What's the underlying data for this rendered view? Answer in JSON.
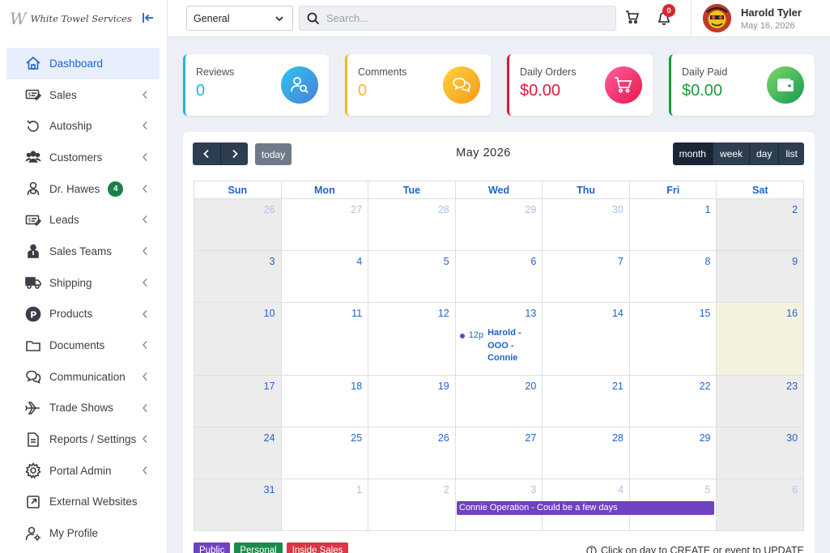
{
  "brand": {
    "logo_mark": "W",
    "logo_text": "White Towel Services"
  },
  "sidebar": {
    "items": [
      {
        "label": "Dashboard",
        "icon": "home-icon",
        "active": true
      },
      {
        "label": "Sales",
        "icon": "sales-icon"
      },
      {
        "label": "Autoship",
        "icon": "autoship-icon"
      },
      {
        "label": "Customers",
        "icon": "customers-icon"
      },
      {
        "label": "Dr. Hawes",
        "icon": "doctor-icon",
        "badge": "4"
      },
      {
        "label": "Leads",
        "icon": "leads-icon"
      },
      {
        "label": "Sales Teams",
        "icon": "sales-teams-icon"
      },
      {
        "label": "Shipping",
        "icon": "shipping-icon"
      },
      {
        "label": "Products",
        "icon": "products-icon"
      },
      {
        "label": "Documents",
        "icon": "folder-icon"
      },
      {
        "label": "Communication",
        "icon": "chat-icon"
      },
      {
        "label": "Trade Shows",
        "icon": "plane-icon"
      },
      {
        "label": "Reports / Settings",
        "icon": "document-icon"
      },
      {
        "label": "Portal Admin",
        "icon": "gear-icon"
      },
      {
        "label": "External Websites",
        "icon": "external-link-icon"
      },
      {
        "label": "My Profile",
        "icon": "user-gear-icon"
      }
    ]
  },
  "topbar": {
    "select_value": "General",
    "search_placeholder": "Search...",
    "notification_count": "0",
    "user_name": "Harold Tyler",
    "user_date": "May 16, 2026"
  },
  "cards": [
    {
      "label": "Reviews",
      "value": "0",
      "color": "#1fb6e8",
      "icon": "search-user-icon"
    },
    {
      "label": "Comments",
      "value": "0",
      "color": "#f5b921",
      "icon": "comments-icon"
    },
    {
      "label": "Daily Orders",
      "value": "$0.00",
      "color": "#e0183c",
      "icon": "cart-icon"
    },
    {
      "label": "Daily Paid",
      "value": "$0.00",
      "color": "#1c9b3c",
      "icon": "wallet-icon"
    }
  ],
  "calendar": {
    "title": "May 2026",
    "today_label": "today",
    "views": [
      "month",
      "week",
      "day",
      "list"
    ],
    "dow": [
      "Sun",
      "Mon",
      "Tue",
      "Wed",
      "Thu",
      "Fri",
      "Sat"
    ],
    "weeks": [
      [
        "26",
        "27",
        "28",
        "29",
        "30",
        "1",
        "2"
      ],
      [
        "3",
        "4",
        "5",
        "6",
        "7",
        "8",
        "9"
      ],
      [
        "10",
        "11",
        "12",
        "13",
        "14",
        "15",
        "16"
      ],
      [
        "17",
        "18",
        "19",
        "20",
        "21",
        "22",
        "23"
      ],
      [
        "24",
        "25",
        "26",
        "27",
        "28",
        "29",
        "30"
      ],
      [
        "31",
        "1",
        "2",
        "3",
        "4",
        "5",
        "6"
      ]
    ],
    "event_time": "12p",
    "event_title": "Harold - OOO - Connie",
    "bar_event": "Connie Operation - Could be a few days",
    "legend": [
      {
        "label": "Public",
        "color": "#6f42c1"
      },
      {
        "label": "Personal",
        "color": "#1c8a4a"
      },
      {
        "label": "Inside Sales",
        "color": "#dc3545"
      }
    ],
    "hint": "Click on day to CREATE or event to UPDATE"
  }
}
